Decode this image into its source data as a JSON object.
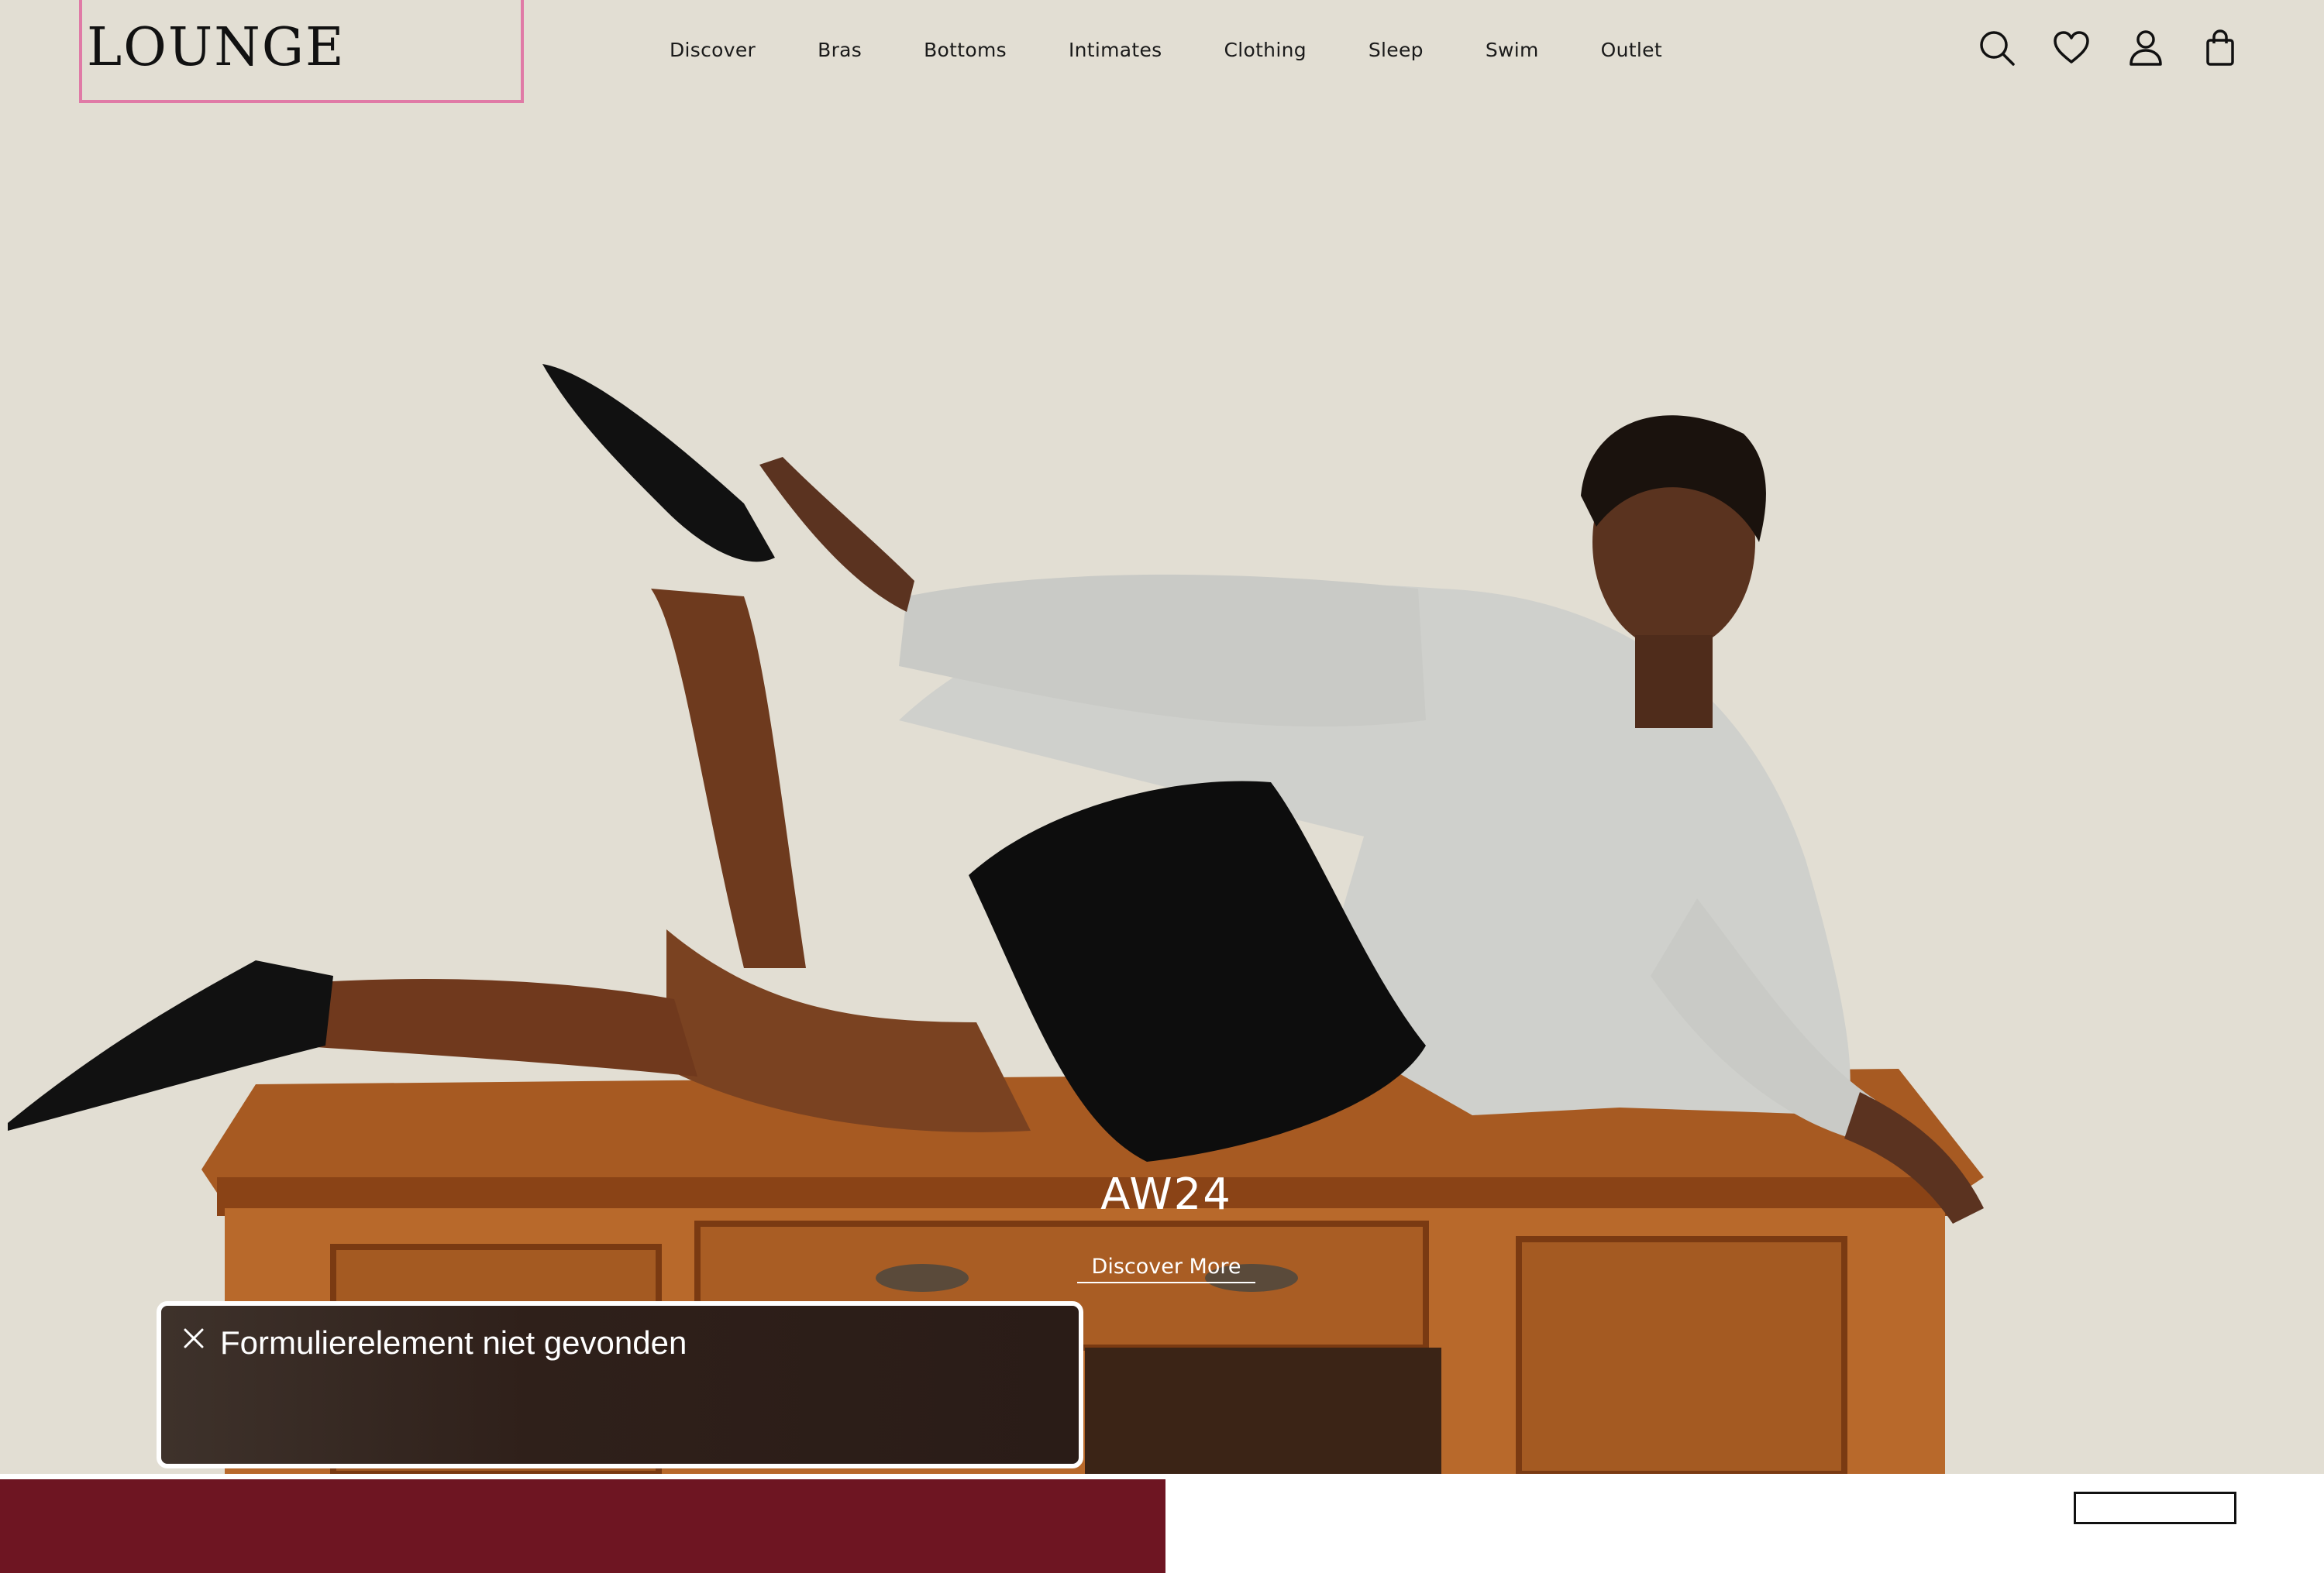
{
  "header": {
    "logo": "LOUNGE",
    "nav": [
      "Discover",
      "Bras",
      "Bottoms",
      "Intimates",
      "Clothing",
      "Sleep",
      "Swim",
      "Outlet"
    ],
    "icons": [
      "search-icon",
      "heart-icon",
      "account-icon",
      "bag-icon"
    ]
  },
  "hero": {
    "title": "AW24",
    "cta": "Discover More"
  },
  "toast": {
    "message": "Formulierelement niet gevonden",
    "icon": "close-icon"
  },
  "colors": {
    "background": "#e1ddd2",
    "logo_outline": "#e07aa6",
    "toast_bg": "#2f201a",
    "bottom_bar": "#6e1522",
    "desk": "#b4642a"
  }
}
